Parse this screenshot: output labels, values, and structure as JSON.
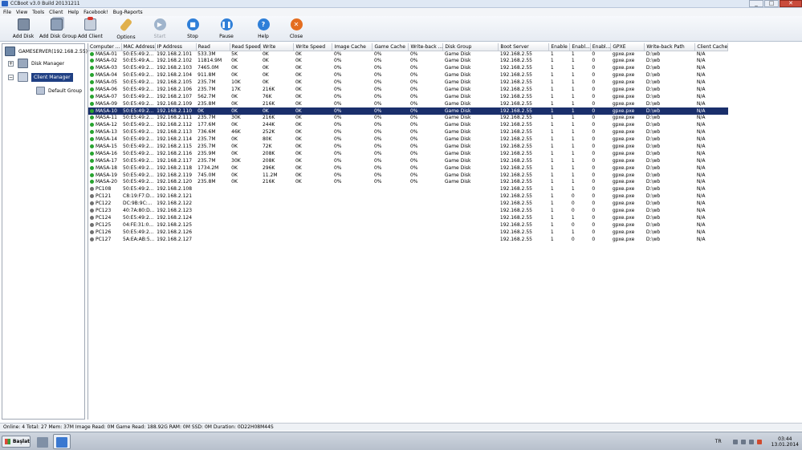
{
  "window": {
    "title": "CCBoot v3.0 Build 20131211",
    "min": "_",
    "max": "□",
    "close": "✕"
  },
  "menu": [
    "File",
    "View",
    "Tools",
    "Client",
    "Help",
    "Facebook!",
    "Bug-Reports"
  ],
  "toolbar": {
    "add_disk": "Add Disk",
    "add_disk_group": "Add Disk Group",
    "add_client": "Add Client",
    "options": "Options",
    "start": "Start",
    "stop": "Stop",
    "pause": "Pause",
    "help": "Help",
    "close": "Close"
  },
  "tree": {
    "server": "GAMESERVER(192.168.2.55)",
    "disk_manager": "Disk Manager",
    "client_manager": "Client Manager",
    "default_group": "Default Group"
  },
  "columns": [
    "Computer ...",
    "MAC Address",
    "IP Address",
    "Read",
    "Read Speed",
    "Write",
    "Write Speed",
    "Image Cache",
    "Game Cache",
    "Write-back ...",
    "Disk Group",
    "Boot Server",
    "Enable",
    "Enabl...",
    "Enabl...",
    "GPXE",
    "Write-back Path",
    "Client Cache"
  ],
  "rows": [
    {
      "name": "MASA-01",
      "mac": "50:E5:49:2...",
      "ip": "192.168.2.101",
      "read": "533.3M",
      "rspeed": "5K",
      "write": "0K",
      "wspeed": "0K",
      "icache": "0%",
      "gcache": "0%",
      "wb": "0%",
      "dgroup": "Game Disk",
      "boot": "192.168.2.55",
      "e1": "1",
      "e2": "1",
      "e3": "0",
      "gpxe": "gpxe.pxe",
      "wbpath": "D:\\wb",
      "ccache": "N/A",
      "online": true
    },
    {
      "name": "MASA-02",
      "mac": "50:E5:49:A...",
      "ip": "192.168.2.102",
      "read": "11814.9M",
      "rspeed": "0K",
      "write": "0K",
      "wspeed": "0K",
      "icache": "0%",
      "gcache": "0%",
      "wb": "0%",
      "dgroup": "Game Disk",
      "boot": "192.168.2.55",
      "e1": "1",
      "e2": "1",
      "e3": "0",
      "gpxe": "gpxe.pxe",
      "wbpath": "D:\\wb",
      "ccache": "N/A",
      "online": true
    },
    {
      "name": "MASA-03",
      "mac": "50:E5:49:2...",
      "ip": "192.168.2.103",
      "read": "7465.0M",
      "rspeed": "0K",
      "write": "0K",
      "wspeed": "0K",
      "icache": "0%",
      "gcache": "0%",
      "wb": "0%",
      "dgroup": "Game Disk",
      "boot": "192.168.2.55",
      "e1": "1",
      "e2": "1",
      "e3": "0",
      "gpxe": "gpxe.pxe",
      "wbpath": "D:\\wb",
      "ccache": "N/A",
      "online": true
    },
    {
      "name": "MASA-04",
      "mac": "50:E5:49:2...",
      "ip": "192.168.2.104",
      "read": "911.8M",
      "rspeed": "0K",
      "write": "0K",
      "wspeed": "0K",
      "icache": "0%",
      "gcache": "0%",
      "wb": "0%",
      "dgroup": "Game Disk",
      "boot": "192.168.2.55",
      "e1": "1",
      "e2": "1",
      "e3": "0",
      "gpxe": "gpxe.pxe",
      "wbpath": "D:\\wb",
      "ccache": "N/A",
      "online": true
    },
    {
      "name": "MASA-05",
      "mac": "50:E5:49:2...",
      "ip": "192.168.2.105",
      "read": "235.7M",
      "rspeed": "10K",
      "write": "0K",
      "wspeed": "0K",
      "icache": "0%",
      "gcache": "0%",
      "wb": "0%",
      "dgroup": "Game Disk",
      "boot": "192.168.2.55",
      "e1": "1",
      "e2": "1",
      "e3": "0",
      "gpxe": "gpxe.pxe",
      "wbpath": "D:\\wb",
      "ccache": "N/A",
      "online": true
    },
    {
      "name": "MASA-06",
      "mac": "50:E5:49:2...",
      "ip": "192.168.2.106",
      "read": "235.7M",
      "rspeed": "17K",
      "write": "216K",
      "wspeed": "0K",
      "icache": "0%",
      "gcache": "0%",
      "wb": "0%",
      "dgroup": "Game Disk",
      "boot": "192.168.2.55",
      "e1": "1",
      "e2": "1",
      "e3": "0",
      "gpxe": "gpxe.pxe",
      "wbpath": "D:\\wb",
      "ccache": "N/A",
      "online": true
    },
    {
      "name": "MASA-07",
      "mac": "50:E5:49:2...",
      "ip": "192.168.2.107",
      "read": "562.7M",
      "rspeed": "0K",
      "write": "76K",
      "wspeed": "0K",
      "icache": "0%",
      "gcache": "0%",
      "wb": "0%",
      "dgroup": "Game Disk",
      "boot": "192.168.2.55",
      "e1": "1",
      "e2": "1",
      "e3": "0",
      "gpxe": "gpxe.pxe",
      "wbpath": "D:\\wb",
      "ccache": "N/A",
      "online": true
    },
    {
      "name": "MASA-09",
      "mac": "50:E5:49:2...",
      "ip": "192.168.2.109",
      "read": "235.8M",
      "rspeed": "0K",
      "write": "216K",
      "wspeed": "0K",
      "icache": "0%",
      "gcache": "0%",
      "wb": "0%",
      "dgroup": "Game Disk",
      "boot": "192.168.2.55",
      "e1": "1",
      "e2": "1",
      "e3": "0",
      "gpxe": "gpxe.pxe",
      "wbpath": "D:\\wb",
      "ccache": "N/A",
      "online": true
    },
    {
      "name": "MASA-10",
      "mac": "50:E5:49:2...",
      "ip": "192.168.2.110",
      "read": "0K",
      "rspeed": "0K",
      "write": "0K",
      "wspeed": "0K",
      "icache": "0%",
      "gcache": "0%",
      "wb": "0%",
      "dgroup": "Game Disk",
      "boot": "192.168.2.55",
      "e1": "1",
      "e2": "1",
      "e3": "0",
      "gpxe": "gpxe.pxe",
      "wbpath": "D:\\wb",
      "ccache": "N/A",
      "online": true,
      "selected": true
    },
    {
      "name": "MASA-11",
      "mac": "50:E5:49:2...",
      "ip": "192.168.2.111",
      "read": "235.7M",
      "rspeed": "30K",
      "write": "216K",
      "wspeed": "0K",
      "icache": "0%",
      "gcache": "0%",
      "wb": "0%",
      "dgroup": "Game Disk",
      "boot": "192.168.2.55",
      "e1": "1",
      "e2": "1",
      "e3": "0",
      "gpxe": "gpxe.pxe",
      "wbpath": "D:\\wb",
      "ccache": "N/A",
      "online": true
    },
    {
      "name": "MASA-12",
      "mac": "50:E5:49:2...",
      "ip": "192.168.2.112",
      "read": "177.6M",
      "rspeed": "0K",
      "write": "244K",
      "wspeed": "0K",
      "icache": "0%",
      "gcache": "0%",
      "wb": "0%",
      "dgroup": "Game Disk",
      "boot": "192.168.2.55",
      "e1": "1",
      "e2": "1",
      "e3": "0",
      "gpxe": "gpxe.pxe",
      "wbpath": "D:\\wb",
      "ccache": "N/A",
      "online": true
    },
    {
      "name": "MASA-13",
      "mac": "50:E5:49:2...",
      "ip": "192.168.2.113",
      "read": "736.6M",
      "rspeed": "46K",
      "write": "252K",
      "wspeed": "0K",
      "icache": "0%",
      "gcache": "0%",
      "wb": "0%",
      "dgroup": "Game Disk",
      "boot": "192.168.2.55",
      "e1": "1",
      "e2": "1",
      "e3": "0",
      "gpxe": "gpxe.pxe",
      "wbpath": "D:\\wb",
      "ccache": "N/A",
      "online": true
    },
    {
      "name": "MASA-14",
      "mac": "50:E5:49:2...",
      "ip": "192.168.2.114",
      "read": "235.7M",
      "rspeed": "0K",
      "write": "80K",
      "wspeed": "0K",
      "icache": "0%",
      "gcache": "0%",
      "wb": "0%",
      "dgroup": "Game Disk",
      "boot": "192.168.2.55",
      "e1": "1",
      "e2": "1",
      "e3": "0",
      "gpxe": "gpxe.pxe",
      "wbpath": "D:\\wb",
      "ccache": "N/A",
      "online": true
    },
    {
      "name": "MASA-15",
      "mac": "50:E5:49:2...",
      "ip": "192.168.2.115",
      "read": "235.7M",
      "rspeed": "0K",
      "write": "72K",
      "wspeed": "0K",
      "icache": "0%",
      "gcache": "0%",
      "wb": "0%",
      "dgroup": "Game Disk",
      "boot": "192.168.2.55",
      "e1": "1",
      "e2": "1",
      "e3": "0",
      "gpxe": "gpxe.pxe",
      "wbpath": "D:\\wb",
      "ccache": "N/A",
      "online": true
    },
    {
      "name": "MASA-16",
      "mac": "50:E5:49:2...",
      "ip": "192.168.2.116",
      "read": "235.9M",
      "rspeed": "0K",
      "write": "208K",
      "wspeed": "0K",
      "icache": "0%",
      "gcache": "0%",
      "wb": "0%",
      "dgroup": "Game Disk",
      "boot": "192.168.2.55",
      "e1": "1",
      "e2": "1",
      "e3": "0",
      "gpxe": "gpxe.pxe",
      "wbpath": "D:\\wb",
      "ccache": "N/A",
      "online": true
    },
    {
      "name": "MASA-17",
      "mac": "50:E5:49:2...",
      "ip": "192.168.2.117",
      "read": "235.7M",
      "rspeed": "30K",
      "write": "208K",
      "wspeed": "0K",
      "icache": "0%",
      "gcache": "0%",
      "wb": "0%",
      "dgroup": "Game Disk",
      "boot": "192.168.2.55",
      "e1": "1",
      "e2": "1",
      "e3": "0",
      "gpxe": "gpxe.pxe",
      "wbpath": "D:\\wb",
      "ccache": "N/A",
      "online": true
    },
    {
      "name": "MASA-18",
      "mac": "50:E5:49:2...",
      "ip": "192.168.2.118",
      "read": "1734.2M",
      "rspeed": "0K",
      "write": "296K",
      "wspeed": "0K",
      "icache": "0%",
      "gcache": "0%",
      "wb": "0%",
      "dgroup": "Game Disk",
      "boot": "192.168.2.55",
      "e1": "1",
      "e2": "1",
      "e3": "0",
      "gpxe": "gpxe.pxe",
      "wbpath": "D:\\wb",
      "ccache": "N/A",
      "online": true
    },
    {
      "name": "MASA-19",
      "mac": "50:E5:49:2...",
      "ip": "192.168.2.119",
      "read": "745.0M",
      "rspeed": "0K",
      "write": "11.2M",
      "wspeed": "0K",
      "icache": "0%",
      "gcache": "0%",
      "wb": "0%",
      "dgroup": "Game Disk",
      "boot": "192.168.2.55",
      "e1": "1",
      "e2": "1",
      "e3": "0",
      "gpxe": "gpxe.pxe",
      "wbpath": "D:\\wb",
      "ccache": "N/A",
      "online": true
    },
    {
      "name": "MASA-20",
      "mac": "50:E5:49:2...",
      "ip": "192.168.2.120",
      "read": "235.8M",
      "rspeed": "0K",
      "write": "216K",
      "wspeed": "0K",
      "icache": "0%",
      "gcache": "0%",
      "wb": "0%",
      "dgroup": "Game Disk",
      "boot": "192.168.2.55",
      "e1": "1",
      "e2": "1",
      "e3": "0",
      "gpxe": "gpxe.pxe",
      "wbpath": "D:\\wb",
      "ccache": "N/A",
      "online": true
    },
    {
      "name": "PC108",
      "mac": "50:E5:49:2...",
      "ip": "192.168.2.108",
      "read": "",
      "rspeed": "",
      "write": "",
      "wspeed": "",
      "icache": "",
      "gcache": "",
      "wb": "",
      "dgroup": "",
      "boot": "192.168.2.55",
      "e1": "1",
      "e2": "1",
      "e3": "0",
      "gpxe": "gpxe.pxe",
      "wbpath": "D:\\wb",
      "ccache": "N/A",
      "online": false
    },
    {
      "name": "PC121",
      "mac": "C8:19:F7:D...",
      "ip": "192.168.2.121",
      "read": "",
      "rspeed": "",
      "write": "",
      "wspeed": "",
      "icache": "",
      "gcache": "",
      "wb": "",
      "dgroup": "",
      "boot": "192.168.2.55",
      "e1": "1",
      "e2": "0",
      "e3": "0",
      "gpxe": "gpxe.pxe",
      "wbpath": "D:\\wb",
      "ccache": "N/A",
      "online": false
    },
    {
      "name": "PC122",
      "mac": "DC:9B:9C:...",
      "ip": "192.168.2.122",
      "read": "",
      "rspeed": "",
      "write": "",
      "wspeed": "",
      "icache": "",
      "gcache": "",
      "wb": "",
      "dgroup": "",
      "boot": "192.168.2.55",
      "e1": "1",
      "e2": "0",
      "e3": "0",
      "gpxe": "gpxe.pxe",
      "wbpath": "D:\\wb",
      "ccache": "N/A",
      "online": false
    },
    {
      "name": "PC123",
      "mac": "40:7A:80:D...",
      "ip": "192.168.2.123",
      "read": "",
      "rspeed": "",
      "write": "",
      "wspeed": "",
      "icache": "",
      "gcache": "",
      "wb": "",
      "dgroup": "",
      "boot": "192.168.2.55",
      "e1": "1",
      "e2": "0",
      "e3": "0",
      "gpxe": "gpxe.pxe",
      "wbpath": "D:\\wb",
      "ccache": "N/A",
      "online": false
    },
    {
      "name": "PC124",
      "mac": "50:E5:49:2...",
      "ip": "192.168.2.124",
      "read": "",
      "rspeed": "",
      "write": "",
      "wspeed": "",
      "icache": "",
      "gcache": "",
      "wb": "",
      "dgroup": "",
      "boot": "192.168.2.55",
      "e1": "1",
      "e2": "1",
      "e3": "0",
      "gpxe": "gpxe.pxe",
      "wbpath": "D:\\wb",
      "ccache": "N/A",
      "online": false
    },
    {
      "name": "PC125",
      "mac": "04:FE:31:0...",
      "ip": "192.168.2.125",
      "read": "",
      "rspeed": "",
      "write": "",
      "wspeed": "",
      "icache": "",
      "gcache": "",
      "wb": "",
      "dgroup": "",
      "boot": "192.168.2.55",
      "e1": "1",
      "e2": "0",
      "e3": "0",
      "gpxe": "gpxe.pxe",
      "wbpath": "D:\\wb",
      "ccache": "N/A",
      "online": false
    },
    {
      "name": "PC126",
      "mac": "50:E5:49:2...",
      "ip": "192.168.2.126",
      "read": "",
      "rspeed": "",
      "write": "",
      "wspeed": "",
      "icache": "",
      "gcache": "",
      "wb": "",
      "dgroup": "",
      "boot": "192.168.2.55",
      "e1": "1",
      "e2": "1",
      "e3": "0",
      "gpxe": "gpxe.pxe",
      "wbpath": "D:\\wb",
      "ccache": "N/A",
      "online": false
    },
    {
      "name": "PC127",
      "mac": "5A:EA:AB:5...",
      "ip": "192.168.2.127",
      "read": "",
      "rspeed": "",
      "write": "",
      "wspeed": "",
      "icache": "",
      "gcache": "",
      "wb": "",
      "dgroup": "",
      "boot": "192.168.2.55",
      "e1": "1",
      "e2": "0",
      "e3": "0",
      "gpxe": "gpxe.pxe",
      "wbpath": "D:\\wb",
      "ccache": "N/A",
      "online": false
    }
  ],
  "status": "Online: 4 Total: 27 Mem: 37M Image Read: 0M Game Read: 188.92G RAM: 0M SSD: 0M Duration: 0D22H08M44S",
  "taskbar": {
    "start_label": "Başlat",
    "lang": "TR",
    "time": "03:44",
    "date": "13.01.2014"
  },
  "colors": {
    "selection": "#1a2f6b",
    "online_dot": "#27a32f",
    "offline_dot": "#707070"
  }
}
